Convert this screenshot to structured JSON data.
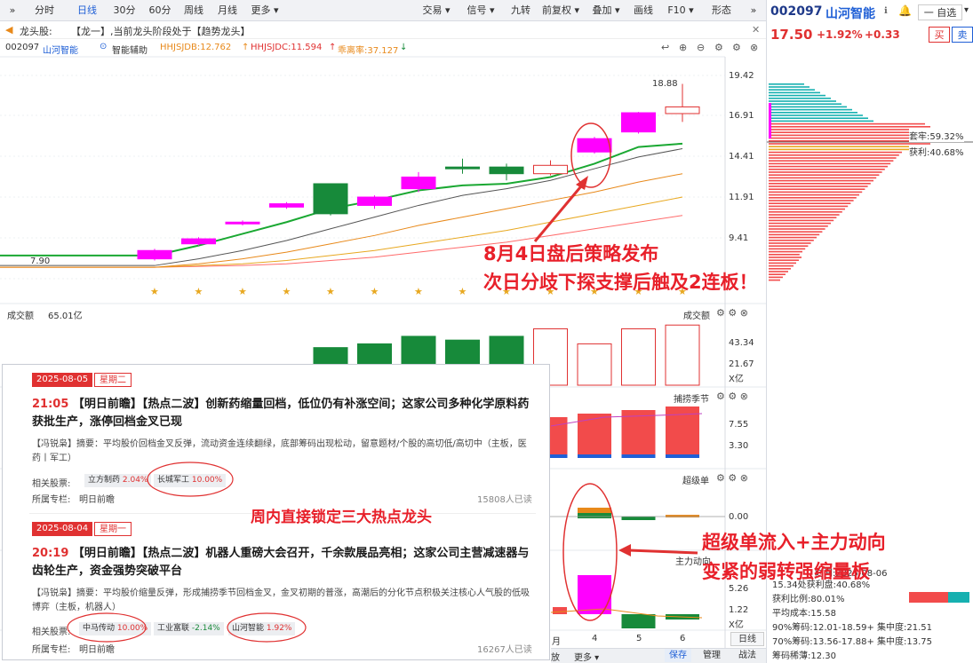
{
  "toolbar": {
    "left_tabs": [
      "分时",
      "日线",
      "30分",
      "60分",
      "周线",
      "月线",
      "更多"
    ],
    "right_tabs": [
      "交易",
      "信号",
      "九转",
      "前复权",
      "叠加",
      "画线",
      "F10",
      "形态"
    ]
  },
  "banner": {
    "label": "龙头股:",
    "text": "【龙一】,当前龙头阶段处于【趋势龙头】"
  },
  "indicator_row": {
    "code": "002097",
    "name": "山河智能",
    "assist": "智能辅助",
    "hhjsjdb": "HHJSJDB:12.762",
    "hhjsjdc": "HHJSJDC:11.594",
    "deviation": "乖离率:37.127"
  },
  "price_axis": [
    "19.42",
    "16.91",
    "14.41",
    "11.91",
    "9.41"
  ],
  "price_labels": {
    "high": "18.88",
    "low": "7.90"
  },
  "volume_panel": {
    "title": "成交额",
    "value": "65.01亿",
    "right_title": "成交额",
    "axis": [
      "43.34",
      "21.67",
      "X亿"
    ]
  },
  "season_panel": {
    "title": "捕捞季节",
    "axis": [
      "7.55",
      "3.30"
    ]
  },
  "super_panel": {
    "title": "超级单",
    "axis": [
      "0.00"
    ]
  },
  "main_panel": {
    "title": "主力动向",
    "axis": [
      "5.26",
      "1.22",
      "X亿"
    ]
  },
  "date_axis": [
    "月",
    "4",
    "5",
    "6"
  ],
  "bottom_buttons": [
    "日线",
    "保存",
    "管理",
    "战法",
    "更多",
    "放"
  ],
  "right_panel": {
    "code": "002097",
    "name": "山河智能",
    "fav": "一 自选",
    "price": "17.50",
    "pct": "+1.92%",
    "chg": "+0.33",
    "buy": "买",
    "sell": "卖",
    "trap": "套牢:59.32%",
    "profit": "获利:40.68%",
    "date": "时间:2025-08-06",
    "stats": [
      "15.34处获利盘:40.68%",
      "获利比例:80.01%",
      "平均成本:15.58",
      "90%筹码:12.01-18.59+ 集中度:21.51",
      "70%筹码:13.56-17.88+ 集中度:13.75",
      "筹码稀薄:12.30"
    ]
  },
  "news": [
    {
      "date": "2025-08-05",
      "weekday": "星期二",
      "time": "21:05",
      "title": "【明日前瞻】【热点二波】创新药缩量回档，低位仍有补涨空间；这家公司多种化学原料药获批生产，涨停回档金叉已现",
      "author": "【冯锐枭】",
      "summary": "摘要：平均股价回档金叉反弹，流动资金连续翻绿，底部筹码出现松动，留意题材/个股的高切低/高切中（主板，医药丨军工）",
      "related_label": "相关股票:",
      "stocks": [
        {
          "name": "立方制药",
          "pct": "2.04%"
        },
        {
          "name": "长城军工",
          "pct": "10.00%"
        }
      ],
      "column_label": "所属专栏:",
      "column": "明日前瞻",
      "reads": "15808人已读"
    },
    {
      "date": "2025-08-04",
      "weekday": "星期一",
      "time": "20:19",
      "title": "【明日前瞻】【热点二波】机器人重磅大会召开，千余款展品亮相；这家公司主营减速器与齿轮生产，资金强势突破平台",
      "author": "【冯锐枭】",
      "summary": "摘要：平均股价缩量反弹，形成捕捞季节回档金叉，金叉初期的普涨，高潮后的分化节点积极关注核心人气股的低吸博弈（主板，机器人）",
      "related_label": "相关股票:",
      "stocks": [
        {
          "name": "中马传动",
          "pct": "10.00%"
        },
        {
          "name": "工业富联",
          "pct": "-2.14%"
        },
        {
          "name": "山河智能",
          "pct": "1.92%"
        }
      ],
      "column_label": "所属专栏:",
      "column": "明日前瞻",
      "reads": "16267人已读"
    }
  ],
  "annotations": {
    "a1_line1": "8月4日盘后策略发布",
    "a1_line2": "次日分歧下探支撑后触及2连板！",
    "a2": "周内直接锁定三大热点龙头",
    "a3_line1": "超级单流入+主力动向",
    "a3_line2": "变紧的弱转强缩量板"
  },
  "colors": {
    "up": "#e03131",
    "down": "#178a3a",
    "magenta": "#ff00ff",
    "accent": "#1f5fd6"
  },
  "chart_data": {
    "type": "candlestick",
    "ylim": [
      7.0,
      20.5
    ],
    "candles": [
      {
        "o": 8.4,
        "c": 8.9,
        "h": 9.0,
        "l": 8.3,
        "color": "magenta"
      },
      {
        "o": 9.3,
        "c": 9.6,
        "h": 9.7,
        "l": 9.2,
        "color": "magenta"
      },
      {
        "o": 10.5,
        "c": 10.6,
        "h": 10.7,
        "l": 10.4,
        "color": "magenta"
      },
      {
        "o": 11.5,
        "c": 11.7,
        "h": 11.8,
        "l": 11.4,
        "color": "magenta"
      },
      {
        "o": 12.9,
        "c": 11.1,
        "h": 12.9,
        "l": 11.0,
        "color": "green"
      },
      {
        "o": 11.6,
        "c": 12.1,
        "h": 12.2,
        "l": 11.4,
        "color": "magenta"
      },
      {
        "o": 12.6,
        "c": 13.3,
        "h": 13.6,
        "l": 12.4,
        "color": "magenta"
      },
      {
        "o": 13.9,
        "c": 13.8,
        "h": 14.4,
        "l": 13.5,
        "color": "green"
      },
      {
        "o": 13.9,
        "c": 13.5,
        "h": 14.1,
        "l": 13.1,
        "color": "green"
      },
      {
        "o": 13.5,
        "c": 14.0,
        "h": 14.3,
        "l": 13.4,
        "color": "redhollow"
      },
      {
        "o": 14.8,
        "c": 15.6,
        "h": 15.7,
        "l": 14.7,
        "color": "magenta"
      },
      {
        "o": 16.0,
        "c": 17.15,
        "h": 17.2,
        "l": 15.9,
        "color": "magenta"
      },
      {
        "o": 17.1,
        "c": 17.5,
        "h": 18.88,
        "l": 16.6,
        "color": "redhollow"
      }
    ],
    "ma_green": [
      8.6,
      9.2,
      9.9,
      10.6,
      11.4,
      11.9,
      12.5,
      12.8,
      12.9,
      13.3,
      14.1,
      15.1,
      15.3
    ],
    "ma_gray": [
      8.0,
      8.4,
      8.9,
      9.5,
      10.2,
      10.9,
      11.6,
      12.2,
      12.6,
      13.1,
      13.8,
      14.5,
      15.0
    ],
    "ma_orange": [
      7.9,
      8.1,
      8.4,
      8.8,
      9.3,
      9.8,
      10.4,
      10.9,
      11.4,
      11.9,
      12.4,
      13.0,
      13.5
    ],
    "ma_yellow": [
      7.9,
      8.0,
      8.1,
      8.3,
      8.6,
      8.9,
      9.3,
      9.7,
      10.1,
      10.6,
      11.1,
      11.6,
      12.1
    ],
    "ma_red": [
      7.9,
      7.95,
      8.0,
      8.1,
      8.3,
      8.5,
      8.8,
      9.1,
      9.4,
      9.8,
      10.2,
      10.6,
      11.0
    ],
    "volume": [
      5,
      7,
      9,
      11,
      20,
      22,
      26,
      24,
      26,
      30,
      22,
      30,
      32
    ],
    "volume_colors": [
      "r",
      "r",
      "r",
      "r",
      "g",
      "g",
      "g",
      "g",
      "g",
      "rh",
      "rh",
      "rh",
      "rh"
    ]
  }
}
